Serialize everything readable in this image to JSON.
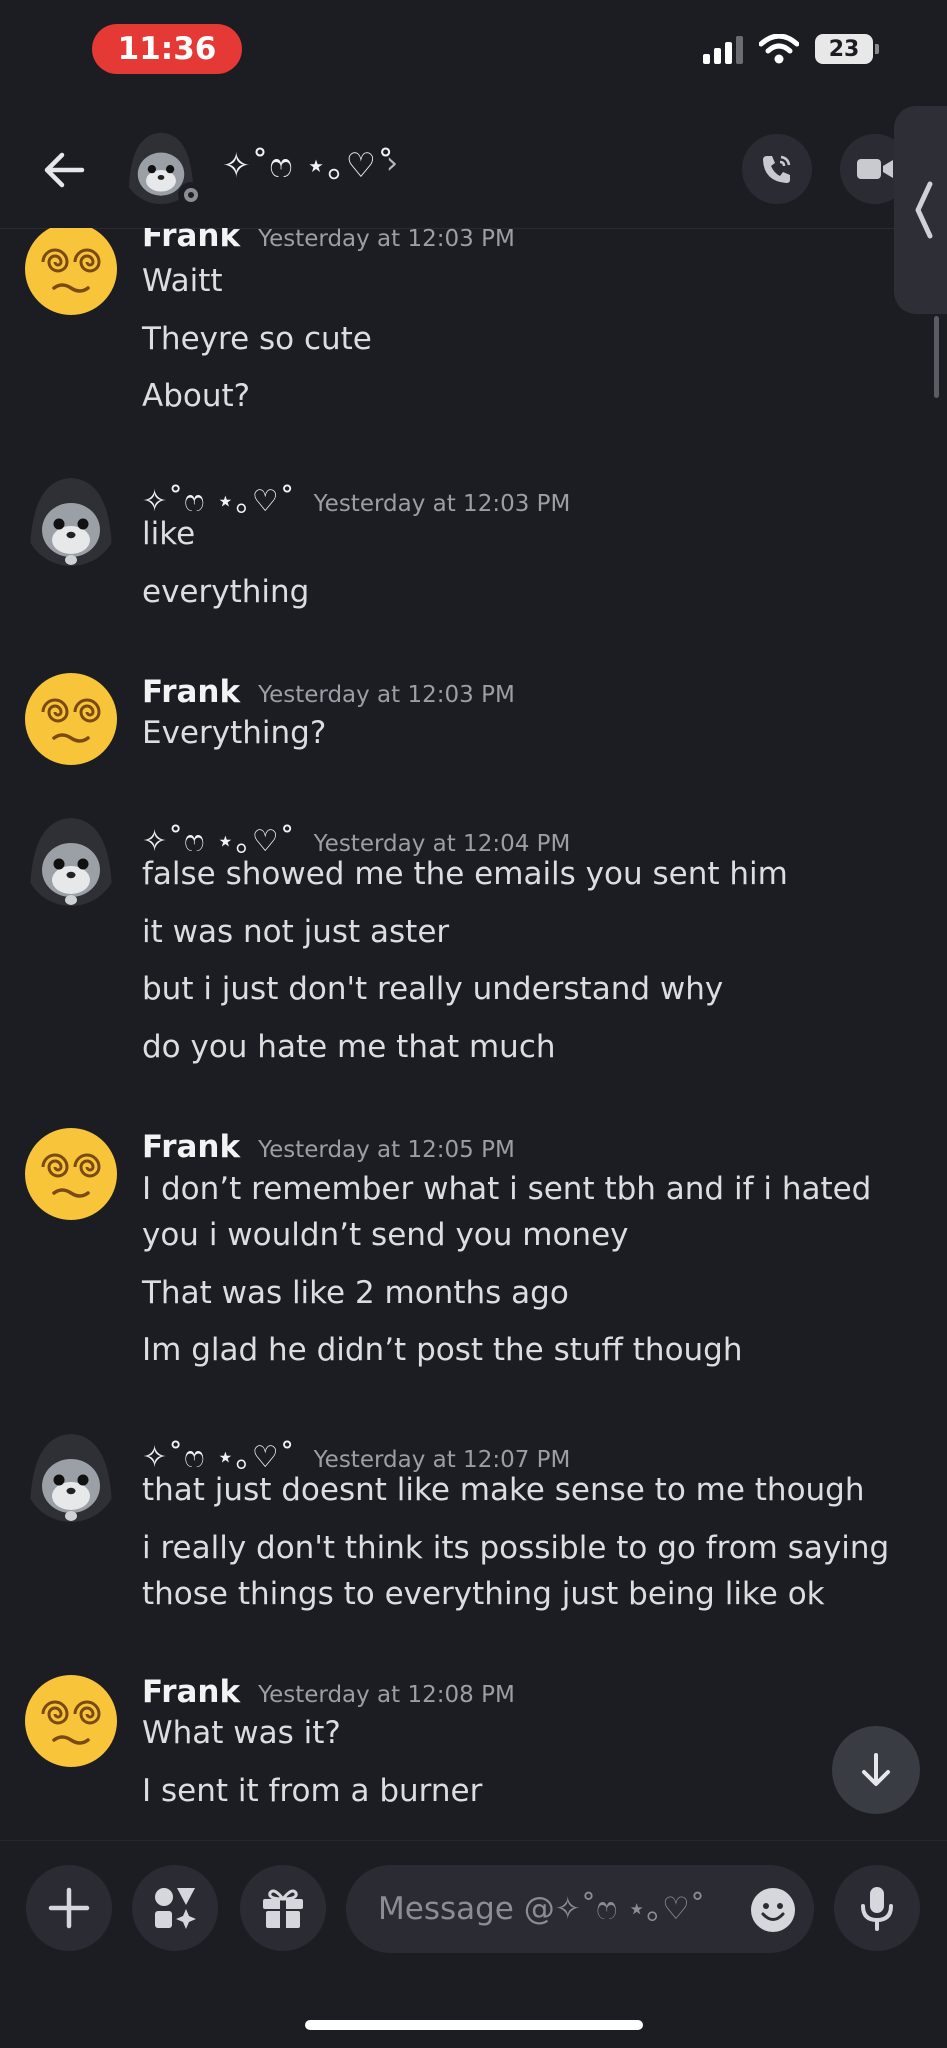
{
  "status": {
    "time": "11:36",
    "battery": "23"
  },
  "header": {
    "title": "✧˚ෆ ⋆｡♡˚",
    "chevron": "›"
  },
  "messages": [
    {
      "author": "Frank",
      "avatar": "dizzy-face-emoji",
      "timestamp": "Yesterday at 12:03 PM",
      "lines": [
        "Waitt",
        "Theyre so cute",
        "About?"
      ]
    },
    {
      "author": "✧˚ෆ ⋆｡♡˚",
      "avatar": "hooded-seal",
      "timestamp": "Yesterday at 12:03 PM",
      "lines": [
        "like",
        "everything"
      ]
    },
    {
      "author": "Frank",
      "avatar": "dizzy-face-emoji",
      "timestamp": "Yesterday at 12:03 PM",
      "lines": [
        "Everything?"
      ]
    },
    {
      "author": "✧˚ෆ ⋆｡♡˚",
      "avatar": "hooded-seal",
      "timestamp": "Yesterday at 12:04 PM",
      "lines": [
        "false showed me the emails you sent him",
        "it was not just aster",
        "but i just don't really understand why",
        "do you hate me that much"
      ]
    },
    {
      "author": "Frank",
      "avatar": "dizzy-face-emoji",
      "timestamp": "Yesterday at 12:05 PM",
      "lines": [
        "I don’t remember what i sent tbh and if i hated you i wouldn’t send you money",
        "That was like 2 months ago",
        "Im glad he didn’t post the stuff though"
      ]
    },
    {
      "author": "✧˚ෆ ⋆｡♡˚",
      "avatar": "hooded-seal",
      "timestamp": "Yesterday at 12:07 PM",
      "lines": [
        "that just doesnt like make sense to me though",
        "i really don't think its possible to go from saying those things to everything just being like ok"
      ]
    },
    {
      "author": "Frank",
      "avatar": "dizzy-face-emoji",
      "timestamp": "Yesterday at 12:08 PM",
      "lines": [
        "What was it?",
        "I sent it from a burner"
      ]
    }
  ],
  "composer": {
    "placeholder": "Message @✧˚ෆ ⋆｡♡˚"
  },
  "colors": {
    "background": "#1c1d22",
    "surface": "#2b2c33",
    "time_pill": "#e53935"
  }
}
